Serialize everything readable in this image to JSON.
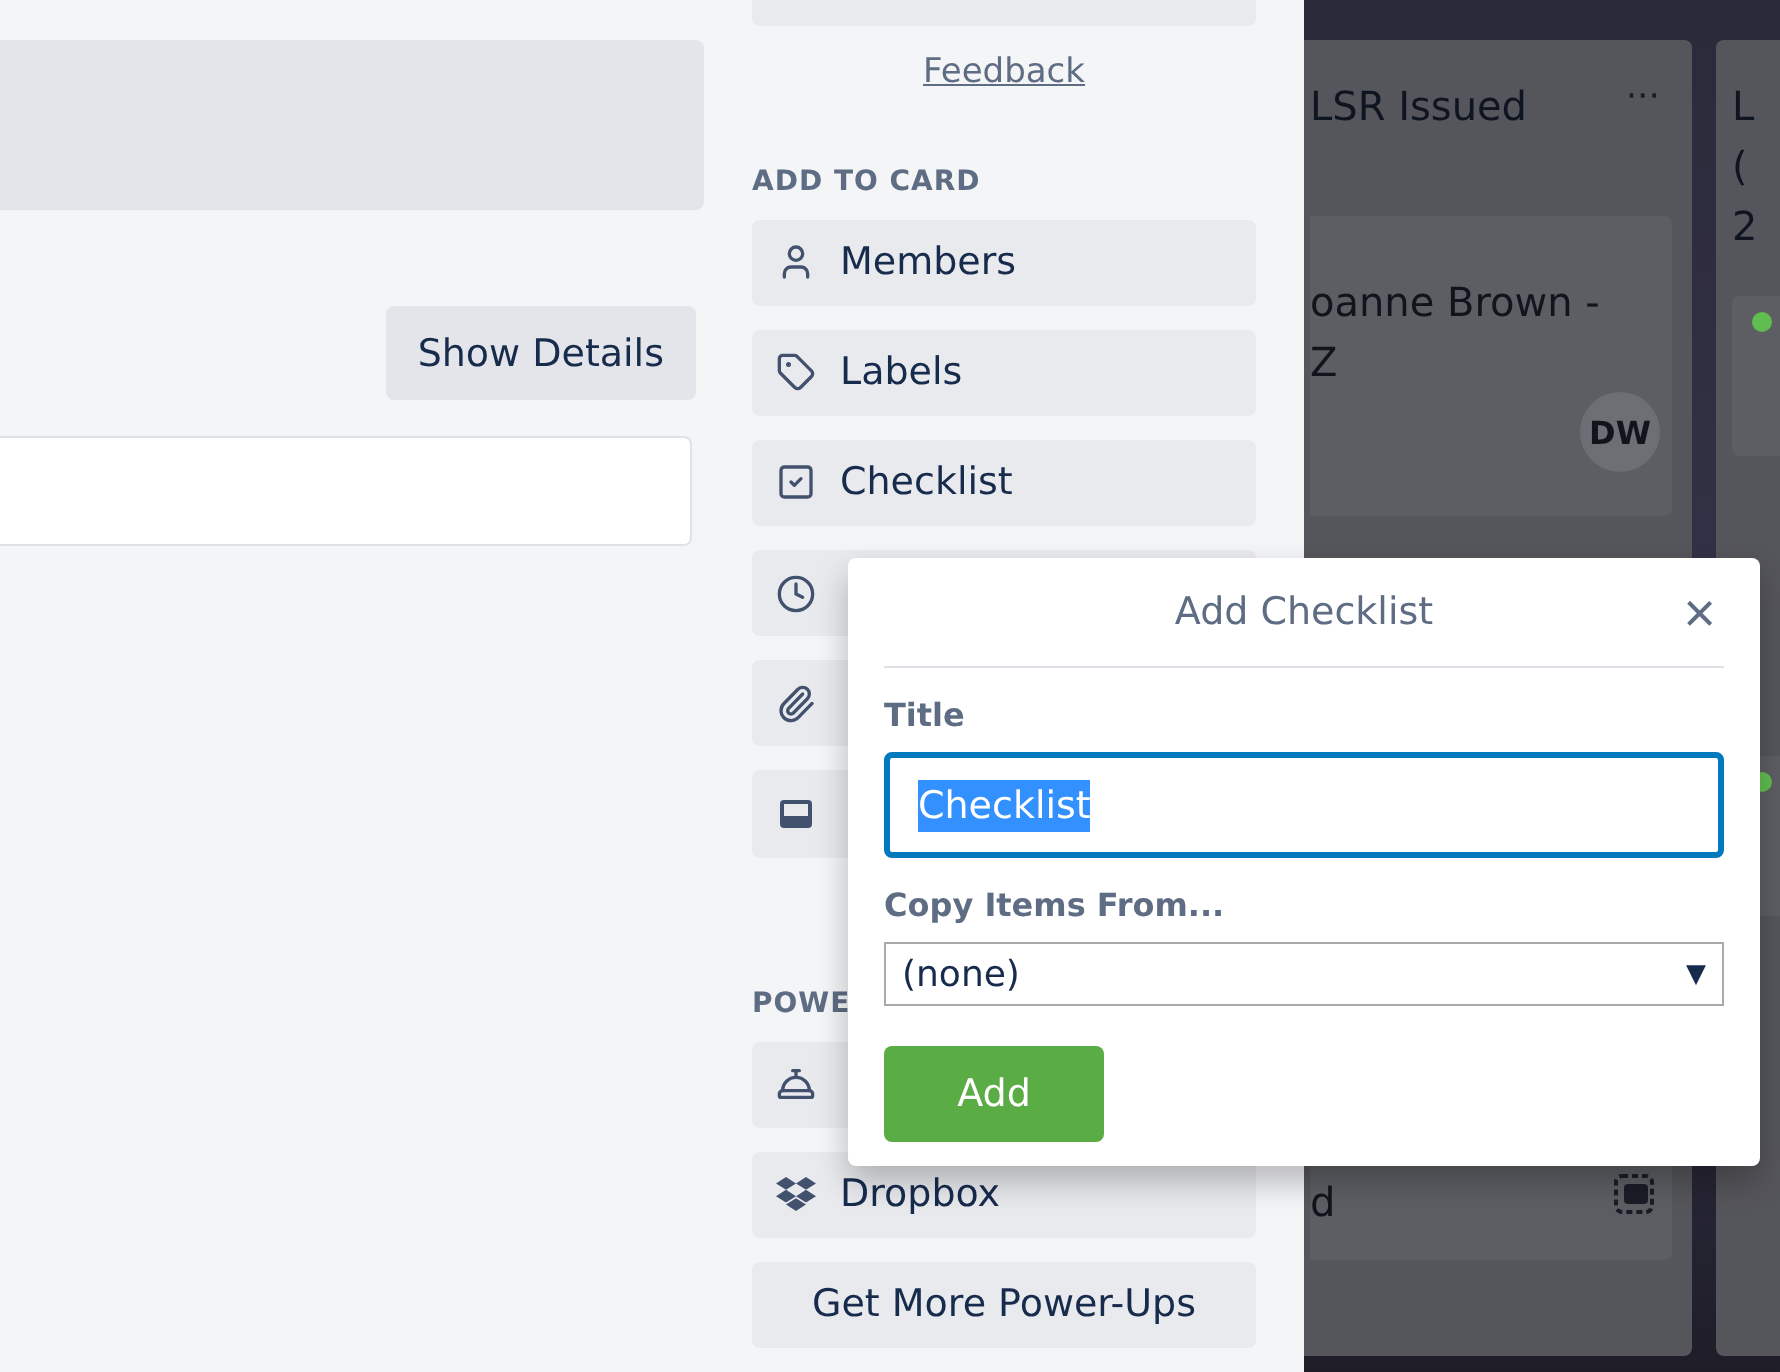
{
  "details": {
    "show_details_button": "Show Details"
  },
  "sidebar": {
    "feedback_link": "Feedback",
    "sections": [
      {
        "heading": "ADD TO CARD",
        "buttons": [
          {
            "kind": "person",
            "label": "Members"
          },
          {
            "kind": "tag",
            "label": "Labels"
          },
          {
            "kind": "checkbox",
            "label": "Checklist"
          },
          {
            "kind": "clock"
          },
          {
            "kind": "paperclip"
          },
          {
            "kind": "cover"
          }
        ]
      },
      {
        "heading": "POWE",
        "buttons": [
          {
            "kind": "bell"
          },
          {
            "kind": "dropbox",
            "label": "Dropbox"
          },
          {
            "kind": "text",
            "label": "Get More Power-Ups"
          }
        ]
      }
    ]
  },
  "board": {
    "lists": [
      {
        "title_lines": [
          "LSR Issued"
        ],
        "menu": "···",
        "cards": [
          {
            "lines": [
              "oanne Brown -",
              "Z"
            ],
            "avatar": "DW"
          },
          {
            "lines": [
              "d"
            ],
            "cover_icon": true
          }
        ]
      },
      {
        "title_lines": [
          "L",
          "(",
          "2"
        ],
        "cards": [
          {
            "color": "#61bd4f"
          },
          {
            "color": "#61bd4f"
          }
        ]
      }
    ]
  },
  "popover": {
    "title": "Add Checklist",
    "close": "×",
    "title_label": "Title",
    "title_value": "Checklist",
    "copy_label": "Copy Items From...",
    "copy_value": "(none)",
    "copy_caret": "▼",
    "add_button": "Add"
  }
}
